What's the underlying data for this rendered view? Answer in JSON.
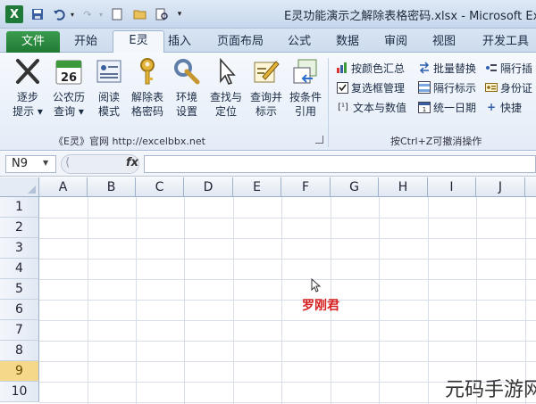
{
  "window": {
    "title": "E灵功能演示之解除表格密码.xlsx - Microsoft Exc"
  },
  "quick_access": {
    "app_icon": "X"
  },
  "tabs": [
    {
      "label": "文件"
    },
    {
      "label": "开始"
    },
    {
      "label": "E灵"
    },
    {
      "label": "插入"
    },
    {
      "label": "页面布局"
    },
    {
      "label": "公式"
    },
    {
      "label": "数据"
    },
    {
      "label": "审阅"
    },
    {
      "label": "视图"
    },
    {
      "label": "开发工具"
    }
  ],
  "ribbon": {
    "big_buttons": [
      {
        "line1": "逐步",
        "line2": "提示 ▾",
        "icon": "scissors-icon"
      },
      {
        "line1": "公农历",
        "line2": "查询 ▾",
        "icon": "calendar-icon",
        "calendar_day": "26"
      },
      {
        "line1": "阅读",
        "line2": "模式",
        "icon": "reading-icon"
      },
      {
        "line1": "解除表",
        "line2": "格密码",
        "icon": "key-icon"
      },
      {
        "line1": "环境",
        "line2": "设置",
        "icon": "tools-icon"
      },
      {
        "line1": "查找与",
        "line2": "定位",
        "icon": "cursor-icon"
      },
      {
        "line1": "查询并",
        "line2": "标示",
        "icon": "edit-icon"
      },
      {
        "line1": "按条件",
        "line2": "引用",
        "icon": "reference-icon"
      }
    ],
    "small_buttons": [
      {
        "label": "按颜色汇总",
        "icon": "color-sum-icon"
      },
      {
        "label": "批量替换",
        "icon": "replace-icon"
      },
      {
        "label": "隔行插",
        "icon": "insert-row-icon"
      },
      {
        "label": "复选框管理",
        "icon": "checkbox-icon"
      },
      {
        "label": "隔行标示",
        "icon": "stripe-icon"
      },
      {
        "label": "身份证",
        "icon": "id-icon"
      },
      {
        "label": "文本与数值",
        "icon": "text-number-icon"
      },
      {
        "label": "统一日期",
        "icon": "date-icon"
      },
      {
        "label": "快捷",
        "icon": "plus-icon"
      }
    ],
    "group_left_label": "《E灵》官网  http://excelbbx.net",
    "group_right_label": "按Ctrl+Z可撤消操作"
  },
  "formula_bar": {
    "name_box": "N9",
    "fx": "fx",
    "value": ""
  },
  "grid": {
    "columns": [
      "A",
      "B",
      "C",
      "D",
      "E",
      "F",
      "G",
      "H",
      "I",
      "J"
    ],
    "rows": [
      "1",
      "2",
      "3",
      "4",
      "5",
      "6",
      "7",
      "8",
      "9",
      "10"
    ],
    "selected_row": "9",
    "cell_text": "罗刚君"
  },
  "watermark": "元码手游网",
  "colors": {
    "file_tab": "#1f7a34",
    "accent_red": "#d61f1f",
    "selected_row": "#f6d88a"
  }
}
